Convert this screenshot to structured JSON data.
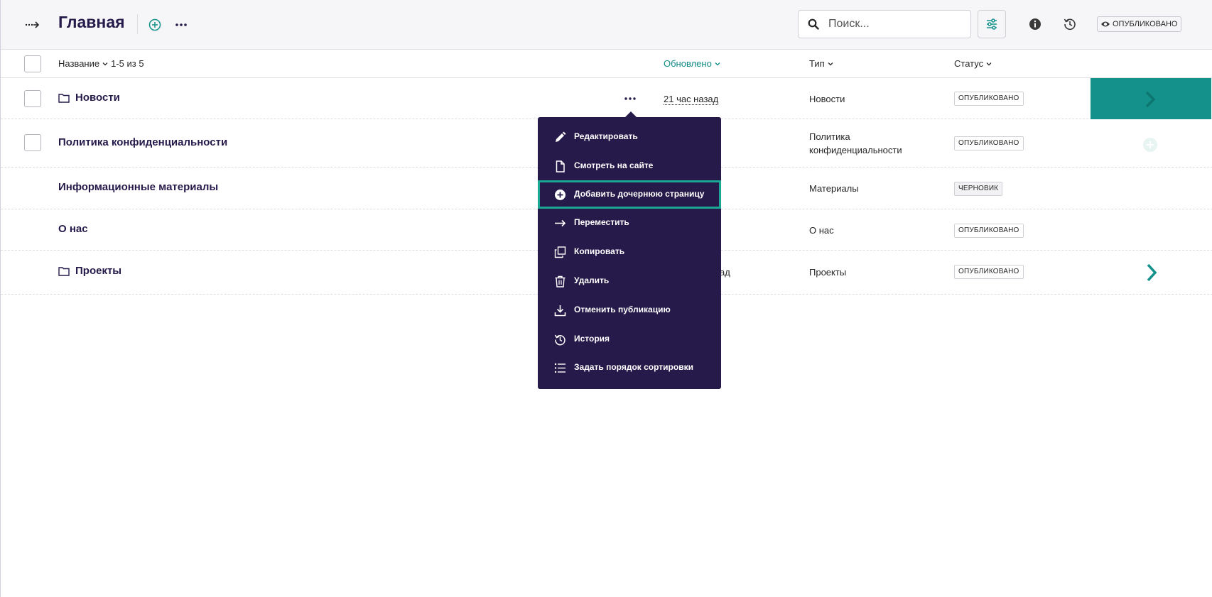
{
  "header": {
    "title": "Главная",
    "search_placeholder": "Поиск...",
    "status_label": "ОПУБЛИКОВАНО"
  },
  "table": {
    "columns": {
      "name": "Название",
      "count": "1-5 из 5",
      "updated": "Обновлено",
      "type": "Тип",
      "status": "Статус"
    },
    "rows": [
      {
        "title": "Новости",
        "updated": "21 час назад",
        "type": "Новости",
        "status": "ОПУБЛИКОВАНО"
      },
      {
        "title": "Политика конфиденциальности",
        "updated": "",
        "type_line1": "Политика",
        "type_line2": "конфиденциальности",
        "status": "ОПУБЛИКОВАНО"
      },
      {
        "title": "Информационные материалы",
        "updated": "",
        "type": "Материалы",
        "status": "ЧЕРНОВИК"
      },
      {
        "title": "О нас",
        "updated": "",
        "type": "О нас",
        "status": "ОПУБЛИКОВАНО"
      },
      {
        "title": "Проекты",
        "updated": "ад",
        "type": "Проекты",
        "status": "ОПУБЛИКОВАНО"
      }
    ]
  },
  "context_menu": {
    "items": [
      {
        "label": "Редактировать",
        "icon": "pencil-icon"
      },
      {
        "label": "Смотреть на сайте",
        "icon": "document-icon"
      },
      {
        "label": "Добавить дочернюю страницу",
        "icon": "plus-circle-icon"
      },
      {
        "label": "Переместить",
        "icon": "arrow-right-icon"
      },
      {
        "label": "Копировать",
        "icon": "copy-icon"
      },
      {
        "label": "Удалить",
        "icon": "trash-icon"
      },
      {
        "label": "Отменить публикацию",
        "icon": "download-icon"
      },
      {
        "label": "История",
        "icon": "history-icon"
      },
      {
        "label": "Задать порядок сортировки",
        "icon": "list-icon"
      }
    ]
  },
  "colors": {
    "primary_dark": "#261a4a",
    "accent_teal": "#14918a",
    "focus_ring": "#1aa894"
  }
}
